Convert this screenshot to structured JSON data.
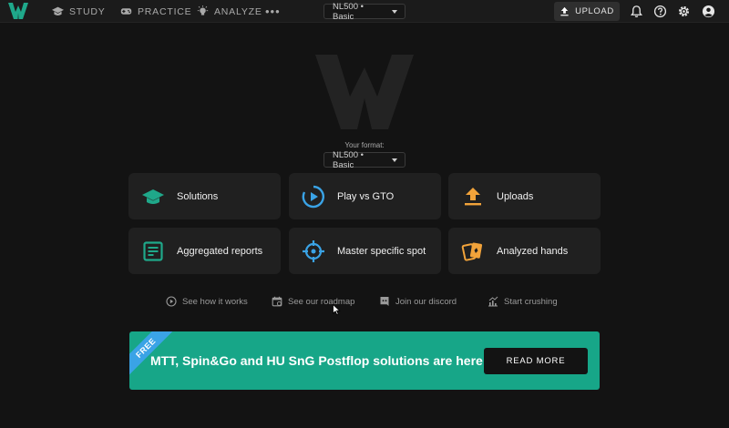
{
  "nav": {
    "study": "STUDY",
    "practice": "PRACTICE",
    "analyze": "ANALYZE",
    "more": "•••",
    "format_select": "NL500 • Basic",
    "upload": "UPLOAD"
  },
  "hero": {
    "format_label": "Your format:",
    "format_select": "NL500 • Basic"
  },
  "cards": [
    {
      "label": "Solutions",
      "icon": "graduation-cap-icon"
    },
    {
      "label": "Play vs GTO",
      "icon": "play-circle-icon"
    },
    {
      "label": "Uploads",
      "icon": "upload-icon"
    },
    {
      "label": "Aggregated reports",
      "icon": "report-icon"
    },
    {
      "label": "Master specific spot",
      "icon": "crosshair-icon"
    },
    {
      "label": "Analyzed hands",
      "icon": "cards-icon"
    }
  ],
  "links": [
    {
      "label": "See how it works",
      "icon": "play-icon"
    },
    {
      "label": "See our roadmap",
      "icon": "calendar-icon"
    },
    {
      "label": "Join our discord",
      "icon": "discord-icon"
    },
    {
      "label": "Start crushing",
      "icon": "chart-icon"
    }
  ],
  "banner": {
    "ribbon": "FREE",
    "text": "MTT, Spin&Go and HU SnG Postflop solutions are here!",
    "button": "READ MORE"
  },
  "colors": {
    "accent_green": "#17a688",
    "icon_teal": "#1fa88a",
    "icon_blue": "#3aa3e6",
    "icon_orange": "#f2a33a",
    "ribbon_blue": "#3aa3e6"
  }
}
